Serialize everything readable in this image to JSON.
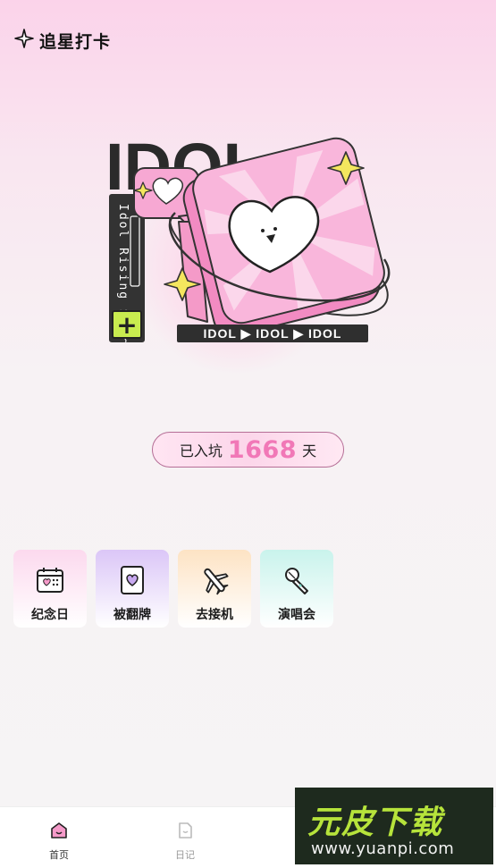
{
  "header": {
    "title": "追星打卡",
    "logo_icon": "sparkle-star-icon"
  },
  "hero": {
    "word": "IDOL",
    "side_text": "Idol Rising Star",
    "strip_text": "IDOL ▶ IDOL ▶ IDOL",
    "plus": "+"
  },
  "counter": {
    "prefix": "已入坑",
    "days": "1668",
    "suffix": "天"
  },
  "shortcuts": [
    {
      "label": "纪念日",
      "icon": "calendar-icon"
    },
    {
      "label": "被翻牌",
      "icon": "flip-card-icon"
    },
    {
      "label": "去接机",
      "icon": "airplane-icon"
    },
    {
      "label": "演唱会",
      "icon": "microphone-icon"
    }
  ],
  "tabbar": [
    {
      "label": "首页",
      "icon": "home-icon",
      "active": true
    },
    {
      "label": "日记",
      "icon": "diary-icon",
      "active": false
    }
  ],
  "watermark": {
    "big": "元皮下载",
    "url": "www.yuanpi.com"
  },
  "colors": {
    "accent_pink": "#f178b7",
    "lime": "#c9ec4f",
    "watermark_green": "#b6e33b"
  }
}
